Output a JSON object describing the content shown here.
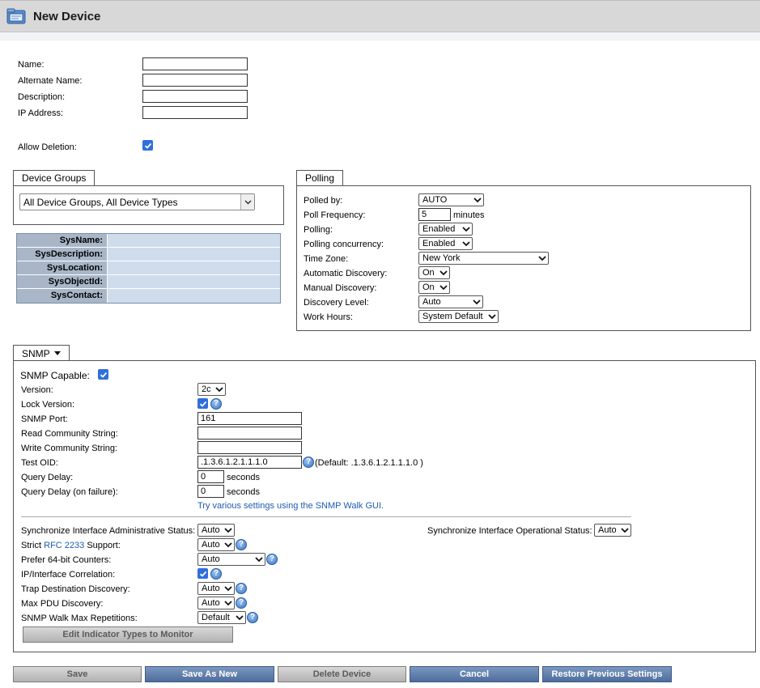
{
  "header": {
    "title": "New Device"
  },
  "form": {
    "name_label": "Name:",
    "alt_name_label": "Alternate Name:",
    "description_label": "Description:",
    "ip_label": "IP Address:",
    "allow_deletion_label": "Allow Deletion:",
    "name_value": "",
    "alt_name_value": "",
    "description_value": "",
    "ip_value": ""
  },
  "device_groups": {
    "tab_label": "Device Groups",
    "selected": "All Device Groups, All Device Types"
  },
  "sys_info": {
    "rows": [
      {
        "key": "SysName:",
        "value": ""
      },
      {
        "key": "SysDescription:",
        "value": ""
      },
      {
        "key": "SysLocation:",
        "value": ""
      },
      {
        "key": "SysObjectId:",
        "value": ""
      },
      {
        "key": "SysContact:",
        "value": ""
      }
    ]
  },
  "polling": {
    "tab_label": "Polling",
    "polled_by_label": "Polled by:",
    "polled_by_value": "AUTO",
    "frequency_label": "Poll Frequency:",
    "frequency_value": "5",
    "frequency_unit": "minutes",
    "polling_label": "Polling:",
    "polling_value": "Enabled",
    "concurrency_label": "Polling concurrency:",
    "concurrency_value": "Enabled",
    "timezone_label": "Time Zone:",
    "timezone_value": "New York",
    "auto_discovery_label": "Automatic Discovery:",
    "auto_discovery_value": "On",
    "manual_discovery_label": "Manual Discovery:",
    "manual_discovery_value": "On",
    "discovery_level_label": "Discovery Level:",
    "discovery_level_value": "Auto",
    "work_hours_label": "Work Hours:",
    "work_hours_value": "System Default"
  },
  "snmp": {
    "tab_label": "SNMP",
    "capable_label": "SNMP Capable:",
    "version_label": "Version:",
    "version_value": "2c",
    "lock_version_label": "Lock Version:",
    "port_label": "SNMP Port:",
    "port_value": "161",
    "read_community_label": "Read Community String:",
    "read_community_value": "",
    "write_community_label": "Write Community String:",
    "write_community_value": "",
    "test_oid_label": "Test OID:",
    "test_oid_value": ".1.3.6.1.2.1.1.1.0",
    "test_oid_default": "(Default: .1.3.6.1.2.1.1.1.0 )",
    "query_delay_label": "Query Delay:",
    "query_delay_value": "0",
    "query_delay_fail_label": "Query Delay (on failure):",
    "query_delay_fail_value": "0",
    "seconds_unit": "seconds",
    "walk_link": "Try various settings using the SNMP Walk GUI.",
    "sync_admin_label": "Synchronize Interface Administrative Status:",
    "sync_admin_value": "Auto",
    "sync_oper_label": "Synchronize Interface Operational Status:",
    "sync_oper_value": "Auto",
    "strict_prefix": "Strict ",
    "strict_link": "RFC 2233",
    "strict_suffix": " Support:",
    "strict_value": "Auto",
    "prefer64_label": "Prefer 64-bit Counters:",
    "prefer64_value": "Auto",
    "ip_corr_label": "IP/Interface Correlation:",
    "trap_label": "Trap Destination Discovery:",
    "trap_value": "Auto",
    "max_pdu_label": "Max PDU Discovery:",
    "max_pdu_value": "Auto",
    "walk_reps_label": "SNMP Walk Max Repetitions:",
    "walk_reps_value": "Default",
    "edit_indicators_button": "Edit Indicator Types to Monitor"
  },
  "footer": {
    "save": "Save",
    "save_as_new": "Save As New",
    "delete_device": "Delete Device",
    "cancel": "Cancel",
    "restore": "Restore Previous Settings"
  }
}
